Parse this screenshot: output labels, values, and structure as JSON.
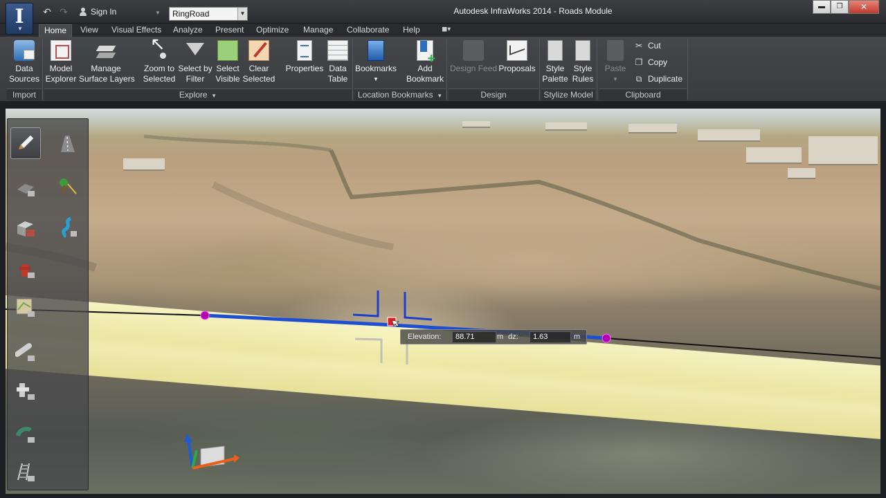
{
  "app": {
    "window_title": "Autodesk InfraWorks 2014 - Roads Module",
    "logo_letter": "I",
    "sign_in_label": "Sign In",
    "model_name": "RingRoad"
  },
  "tabs": [
    "Home",
    "View",
    "Visual Effects",
    "Analyze",
    "Present",
    "Optimize",
    "Manage",
    "Collaborate",
    "Help"
  ],
  "ribbon": {
    "import": {
      "group_label": "Import",
      "data_sources": [
        "Data",
        "Sources"
      ]
    },
    "explore": {
      "group_label": "Explore",
      "model_explorer": [
        "Model",
        "Explorer"
      ],
      "manage_surface_layers": [
        "Manage",
        "Surface Layers"
      ],
      "zoom_to_selected": [
        "Zoom to",
        "Selected"
      ],
      "select_by_filter": [
        "Select by",
        "Filter"
      ],
      "select_visible": [
        "Select",
        "Visible"
      ],
      "clear_selected": [
        "Clear",
        "Selected"
      ],
      "properties": "Properties",
      "data_table": [
        "Data",
        "Table"
      ]
    },
    "location_bookmarks": {
      "group_label": "Location Bookmarks",
      "bookmarks": "Bookmarks",
      "add_bookmark": [
        "Add",
        "Bookmark"
      ]
    },
    "design": {
      "group_label": "Design",
      "design_feed": "Design Feed",
      "proposals": "Proposals"
    },
    "stylize_model": {
      "group_label": "Stylize Model",
      "style_palette": [
        "Style",
        "Palette"
      ],
      "style_rules": [
        "Style",
        "Rules"
      ]
    },
    "clipboard": {
      "group_label": "Clipboard",
      "paste": "Paste",
      "cut": "Cut",
      "copy": "Copy",
      "duplicate": "Duplicate"
    }
  },
  "viewport": {
    "elevation_label": "Elevation:",
    "elevation_value": "88.71",
    "elevation_unit": "m",
    "dz_label": "dz:",
    "dz_value": "1.63",
    "dz_unit": "m"
  },
  "colors": {
    "ribbon_bg": "#46474b",
    "road_fill": "#f6f1b4",
    "alignment_line": "#1f4fd1",
    "vertex_point": "#b400b4",
    "selected_handle": "#e02020"
  }
}
